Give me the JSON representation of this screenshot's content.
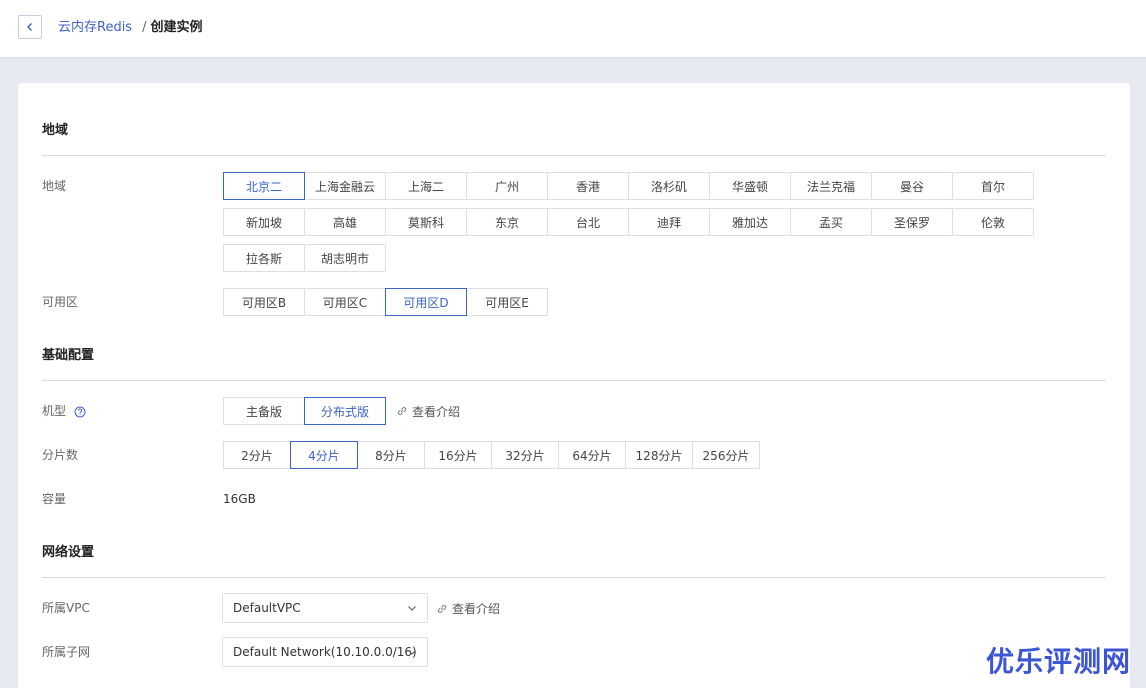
{
  "breadcrumb": {
    "parent": "云内存Redis",
    "separator": "/",
    "current": "创建实例"
  },
  "sections": {
    "region": "地域",
    "basic": "基础配置",
    "network": "网络设置"
  },
  "region": {
    "label": "地域",
    "row1": [
      "北京二",
      "上海金融云",
      "上海二",
      "广州",
      "香港",
      "洛杉矶",
      "华盛顿",
      "法兰克福",
      "曼谷",
      "首尔"
    ],
    "row2": [
      "新加坡",
      "高雄",
      "莫斯科",
      "东京",
      "台北",
      "迪拜",
      "雅加达",
      "孟买",
      "圣保罗",
      "伦敦"
    ],
    "row3": [
      "拉各斯",
      "胡志明市"
    ],
    "selected": "北京二"
  },
  "zone": {
    "label": "可用区",
    "options": [
      "可用区B",
      "可用区C",
      "可用区D",
      "可用区E"
    ],
    "selected": "可用区D"
  },
  "machine": {
    "label": "机型",
    "options": [
      "主备版",
      "分布式版"
    ],
    "selected": "分布式版",
    "link": "查看介绍"
  },
  "shards": {
    "label": "分片数",
    "options": [
      "2分片",
      "4分片",
      "8分片",
      "16分片",
      "32分片",
      "64分片",
      "128分片",
      "256分片"
    ],
    "selected": "4分片"
  },
  "capacity": {
    "label": "容量",
    "value": "16GB"
  },
  "vpc": {
    "label": "所属VPC",
    "value": "DefaultVPC",
    "link": "查看介绍"
  },
  "subnet": {
    "label": "所属子网",
    "value": "Default Network(10.10.0.0/16)"
  },
  "watermark": "优乐评测网",
  "colors": {
    "accent": "#3e63c8",
    "page_bg": "#e8eaf2",
    "watermark": "#3c55d6"
  }
}
